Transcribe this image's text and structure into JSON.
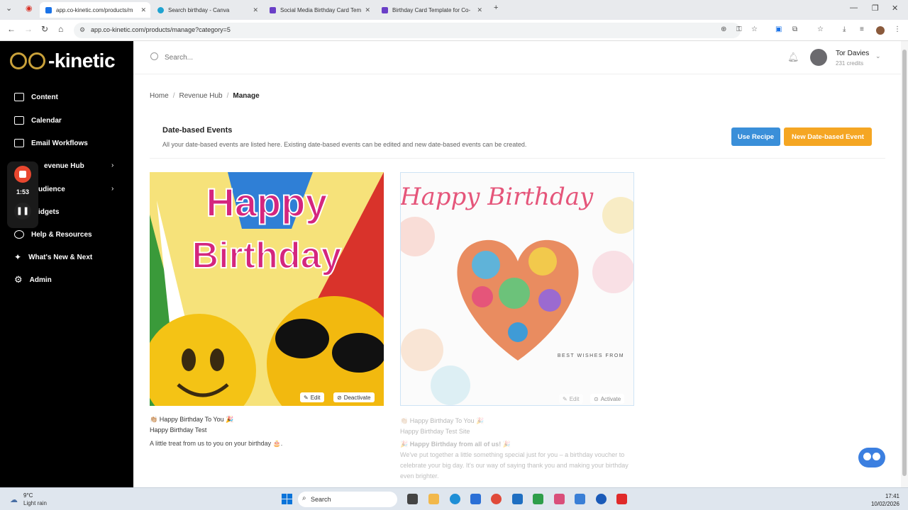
{
  "browser": {
    "tabs": [
      {
        "label": "app.co-kinetic.com/products/m",
        "active": true,
        "favicon_color": "#1a73e8"
      },
      {
        "label": "Search birthday - Canva",
        "active": false,
        "favicon_color": "#1fa3d1"
      },
      {
        "label": "Social Media Birthday Card Tem",
        "active": false,
        "favicon_color": "#6a3fc7"
      },
      {
        "label": "Birthday Card Template for Co-",
        "active": false,
        "favicon_color": "#6a3fc7"
      }
    ],
    "new_tab": "+",
    "url": "app.co-kinetic.com/products/manage?category=5"
  },
  "sidebar": {
    "logo_text": "-kinetic",
    "items": [
      {
        "label": "Content",
        "icon": "content-icon"
      },
      {
        "label": "Calendar",
        "icon": "calendar-icon"
      },
      {
        "label": "Email Workflows",
        "icon": "mail-icon"
      },
      {
        "label": "evenue Hub",
        "icon": "revenue-icon",
        "has_submenu": true
      },
      {
        "label": "udience",
        "icon": "audience-icon",
        "has_submenu": true
      },
      {
        "label": "idgets",
        "icon": "widgets-icon"
      },
      {
        "label": "Help & Resources",
        "icon": "help-icon"
      },
      {
        "label": "What's New & Next",
        "icon": "sparkle-icon"
      },
      {
        "label": "Admin",
        "icon": "gear-icon"
      }
    ],
    "recorder_time": "1:53"
  },
  "topbar": {
    "search_placeholder": "Search...",
    "user_name": "Tor Davies",
    "user_credits": "231 credits"
  },
  "breadcrumb": [
    "Home",
    "Revenue Hub",
    "Manage"
  ],
  "section": {
    "title": "Date-based Events",
    "description": "All your date-based events are listed here. Existing date-based events can be edited and new date-based events can be created.",
    "use_recipe": "Use Recipe",
    "new_event": "New Date-based Event",
    "use_recipe_color": "#3a8fd9",
    "new_event_color": "#f5a623"
  },
  "events": [
    {
      "image_text_1": "Happy",
      "image_text_2": "Birthday",
      "edit_label": "Edit",
      "toggle_label": "Deactivate",
      "title": "👏🏼 Happy Birthday To You 🎉",
      "subtitle": "Happy Birthday Test",
      "description": "A little treat from us to you on your birthday 🎂."
    },
    {
      "image_text_1": "Happy Birthday",
      "image_text_2": "BEST WISHES FROM",
      "edit_label": "Edit",
      "toggle_label": "Activate",
      "title": "👏🏼 Happy Birthday To You 🎉",
      "subtitle": "Happy Birthday Test Site",
      "description_title": "🎉 Happy Birthday from all of us! 🎉",
      "description": "We've put together a little something special just for you – a birthday voucher to celebrate your big day. It's our way of saying thank you and making your birthday even brighter."
    }
  ],
  "taskbar": {
    "weather_temp": "9°C",
    "weather_desc": "Light rain",
    "search": "Search",
    "time": "17:41",
    "date": "10/02/2026"
  }
}
